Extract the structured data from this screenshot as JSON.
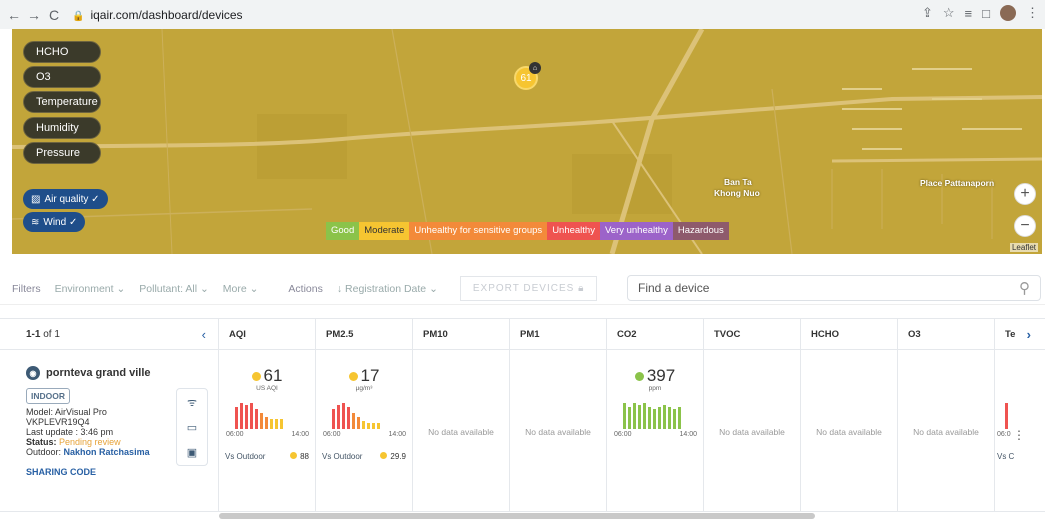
{
  "browser": {
    "url": "iqair.com/dashboard/devices"
  },
  "map": {
    "layers": [
      "HCHO",
      "O3",
      "Temperature",
      "Humidity",
      "Pressure"
    ],
    "toggles": [
      "Air quality ✓",
      "Wind ✓"
    ],
    "marker_value": "61",
    "legend": [
      {
        "label": "Good",
        "color": "#8bc34a"
      },
      {
        "label": "Moderate",
        "color": "#f6c531"
      },
      {
        "label": "Unhealthy for sensitive groups",
        "color": "#f38a3a"
      },
      {
        "label": "Unhealthy",
        "color": "#ef5350"
      },
      {
        "label": "Very unhealthy",
        "color": "#9c63c9"
      },
      {
        "label": "Hazardous",
        "color": "#8e5a6c"
      }
    ],
    "place_labels": [
      "Ban Ta",
      "Khong Nuo",
      "Place Pattanaporn"
    ],
    "attribution": "Leaflet"
  },
  "filters": {
    "label": "Filters",
    "environment": "Environment ⌄",
    "pollutant": "Pollutant: All ⌄",
    "more": "More ⌄",
    "actions": "Actions",
    "sort": "↓ Registration Date ⌄",
    "export": "EXPORT DEVICES",
    "search_placeholder": "Find a device"
  },
  "table": {
    "range": "1-1",
    "of": "of 1",
    "columns": [
      "AQI",
      "PM2.5",
      "PM10",
      "PM1",
      "CO2",
      "TVOC",
      "HCHO",
      "O3",
      "Te"
    ],
    "device": {
      "name": "pornteva grand ville",
      "badge": "INDOOR",
      "model": "Model: AirVisual Pro",
      "serial": "VKPLEVR19Q4",
      "last_update": "Last update : 3:46 pm",
      "status_label": "Status:",
      "status_value": "Pending review",
      "outdoor_label": "Outdoor:",
      "outdoor_value": "Nakhon Ratchasima",
      "sharing": "SHARING CODE"
    },
    "cells": {
      "aqi": {
        "value": "61",
        "unit": "US AQI",
        "t_start": "06:00",
        "t_end": "14:00",
        "vs_label": "Vs Outdoor",
        "vs_value": "88"
      },
      "pm25": {
        "value": "17",
        "unit": "µg/m³",
        "t_start": "06:00",
        "t_end": "14:00",
        "vs_label": "Vs Outdoor",
        "vs_value": "29.9"
      },
      "co2": {
        "value": "397",
        "unit": "ppm",
        "t_start": "06:00",
        "t_end": "14:00"
      },
      "no_data": "No data available",
      "te_partial": {
        "t_start": "06:0",
        "vs_label": "Vs C"
      }
    }
  },
  "colors": {
    "moderate": "#f6c531",
    "good": "#8bc34a",
    "unhealthy": "#ef5350",
    "brand": "#2860a4"
  }
}
